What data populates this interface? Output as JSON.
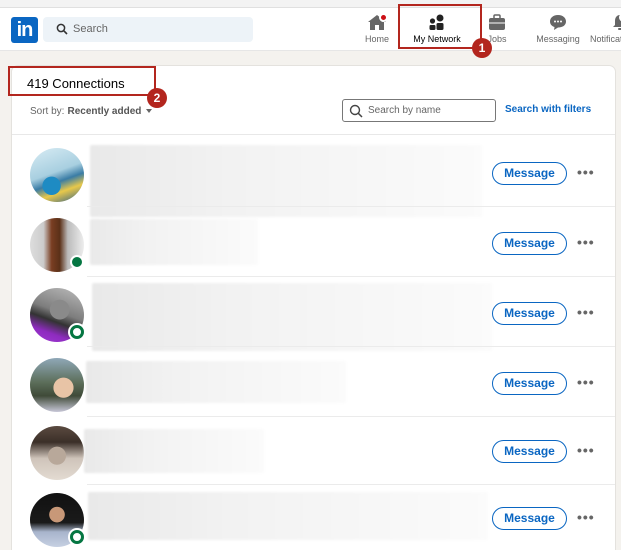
{
  "navbar": {
    "logo_text": "in",
    "search_placeholder": "Search",
    "items": [
      {
        "label": "Home",
        "icon": "home-icon",
        "badge": true
      },
      {
        "label": "My Network",
        "icon": "people-icon",
        "active": true
      },
      {
        "label": "Jobs",
        "icon": "briefcase-icon"
      },
      {
        "label": "Messaging",
        "icon": "chat-icon"
      },
      {
        "label": "Notificat",
        "icon": "bell-icon",
        "badge": true
      }
    ]
  },
  "callouts": [
    "1",
    "2"
  ],
  "connections": {
    "title": "419 Connections",
    "sort_label": "Sort by:",
    "sort_value": "Recently added",
    "search_placeholder": "Search by name",
    "filters_link": "Search with filters",
    "message_label": "Message",
    "more_label": "•••",
    "rows": [
      {
        "avatar": "boat-photo",
        "online": "none"
      },
      {
        "avatar": "hallway-photo",
        "online": "solid"
      },
      {
        "avatar": "bw-portrait-hiring",
        "online": "ring"
      },
      {
        "avatar": "mountain-portrait",
        "online": "none"
      },
      {
        "avatar": "sepia-portrait",
        "online": "none"
      },
      {
        "avatar": "dark-portrait",
        "online": "ring"
      }
    ]
  },
  "colors": {
    "brand": "#0a66c2",
    "callout": "#b3261e",
    "online": "#057642"
  }
}
